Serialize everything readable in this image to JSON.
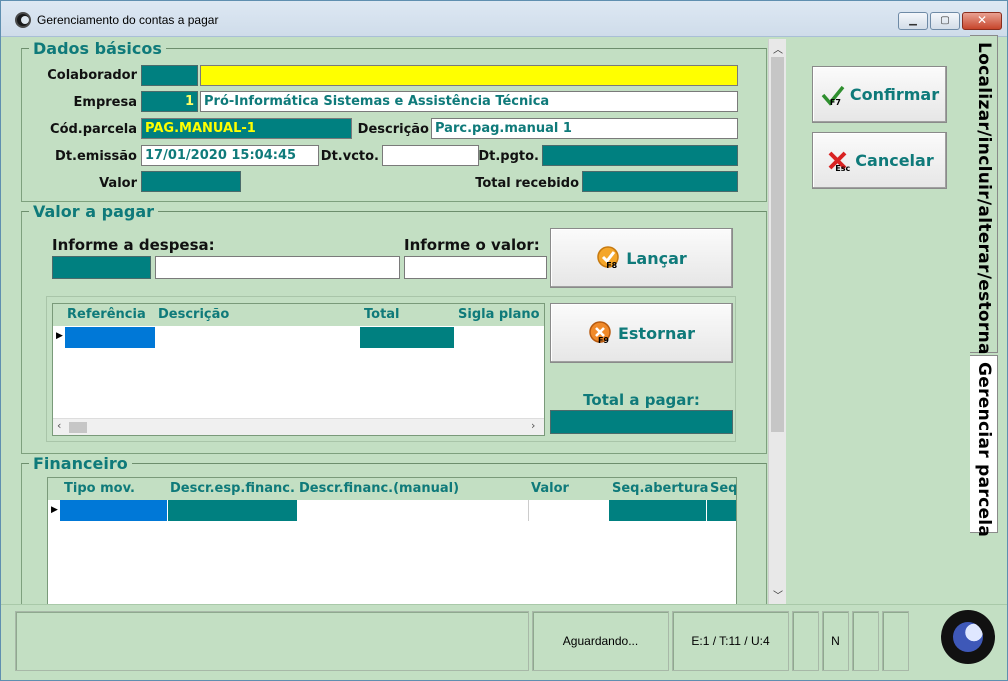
{
  "window": {
    "title": "Gerenciamento do contas a pagar"
  },
  "dados_basicos": {
    "title": "Dados básicos",
    "colaborador": {
      "label": "Colaborador",
      "code": "",
      "name": ""
    },
    "empresa": {
      "label": "Empresa",
      "code": "1",
      "name": "Pró-Informática Sistemas e Assistência Técnica"
    },
    "cod_parcela": {
      "label": "Cód.parcela",
      "value": "PAG.MANUAL-1"
    },
    "descricao": {
      "label": "Descrição",
      "value": "Parc.pag.manual 1"
    },
    "dt_emissao": {
      "label": "Dt.emissão",
      "value": "17/01/2020 15:04:45"
    },
    "dt_vcto": {
      "label": "Dt.vcto.",
      "value": ""
    },
    "dt_pgto": {
      "label": "Dt.pgto.",
      "value": ""
    },
    "valor": {
      "label": "Valor",
      "value": ""
    },
    "total_recebido": {
      "label": "Total recebido",
      "value": ""
    }
  },
  "valor_a_pagar": {
    "title": "Valor a pagar",
    "despesa_label": "Informe a despesa:",
    "valor_label": "Informe o valor:",
    "lancar_button": "Lançar",
    "lancar_key": "F8",
    "estornar_button": "Estornar",
    "estornar_key": "F9",
    "total_label": "Total a pagar:",
    "grid_columns": [
      "Referência",
      "Descrição",
      "Total",
      "Sigla plano c"
    ]
  },
  "financeiro": {
    "title": "Financeiro",
    "grid_columns": [
      "Tipo mov.",
      "Descr.esp.financ.",
      "Descr.financ.(manual)",
      "Valor",
      "Seq.abertura",
      "Seq"
    ]
  },
  "actions": {
    "confirmar": "Confirmar",
    "confirmar_key": "F7",
    "cancelar": "Cancelar",
    "cancelar_key": "Esc"
  },
  "tabs": [
    {
      "label": "Localizar/incluir/alterar/estornar",
      "active": false
    },
    {
      "label": "Gerenciar parcela",
      "active": true
    }
  ],
  "statusbar": {
    "status": "Aguardando...",
    "counts": "E:1 / T:11 / U:4",
    "mode": "N"
  },
  "colors": {
    "background": "#c3dfc3",
    "accent": "#008080",
    "highlight": "#ffff00",
    "selected": "#0078d7",
    "title_text": "#0f7a7a"
  }
}
